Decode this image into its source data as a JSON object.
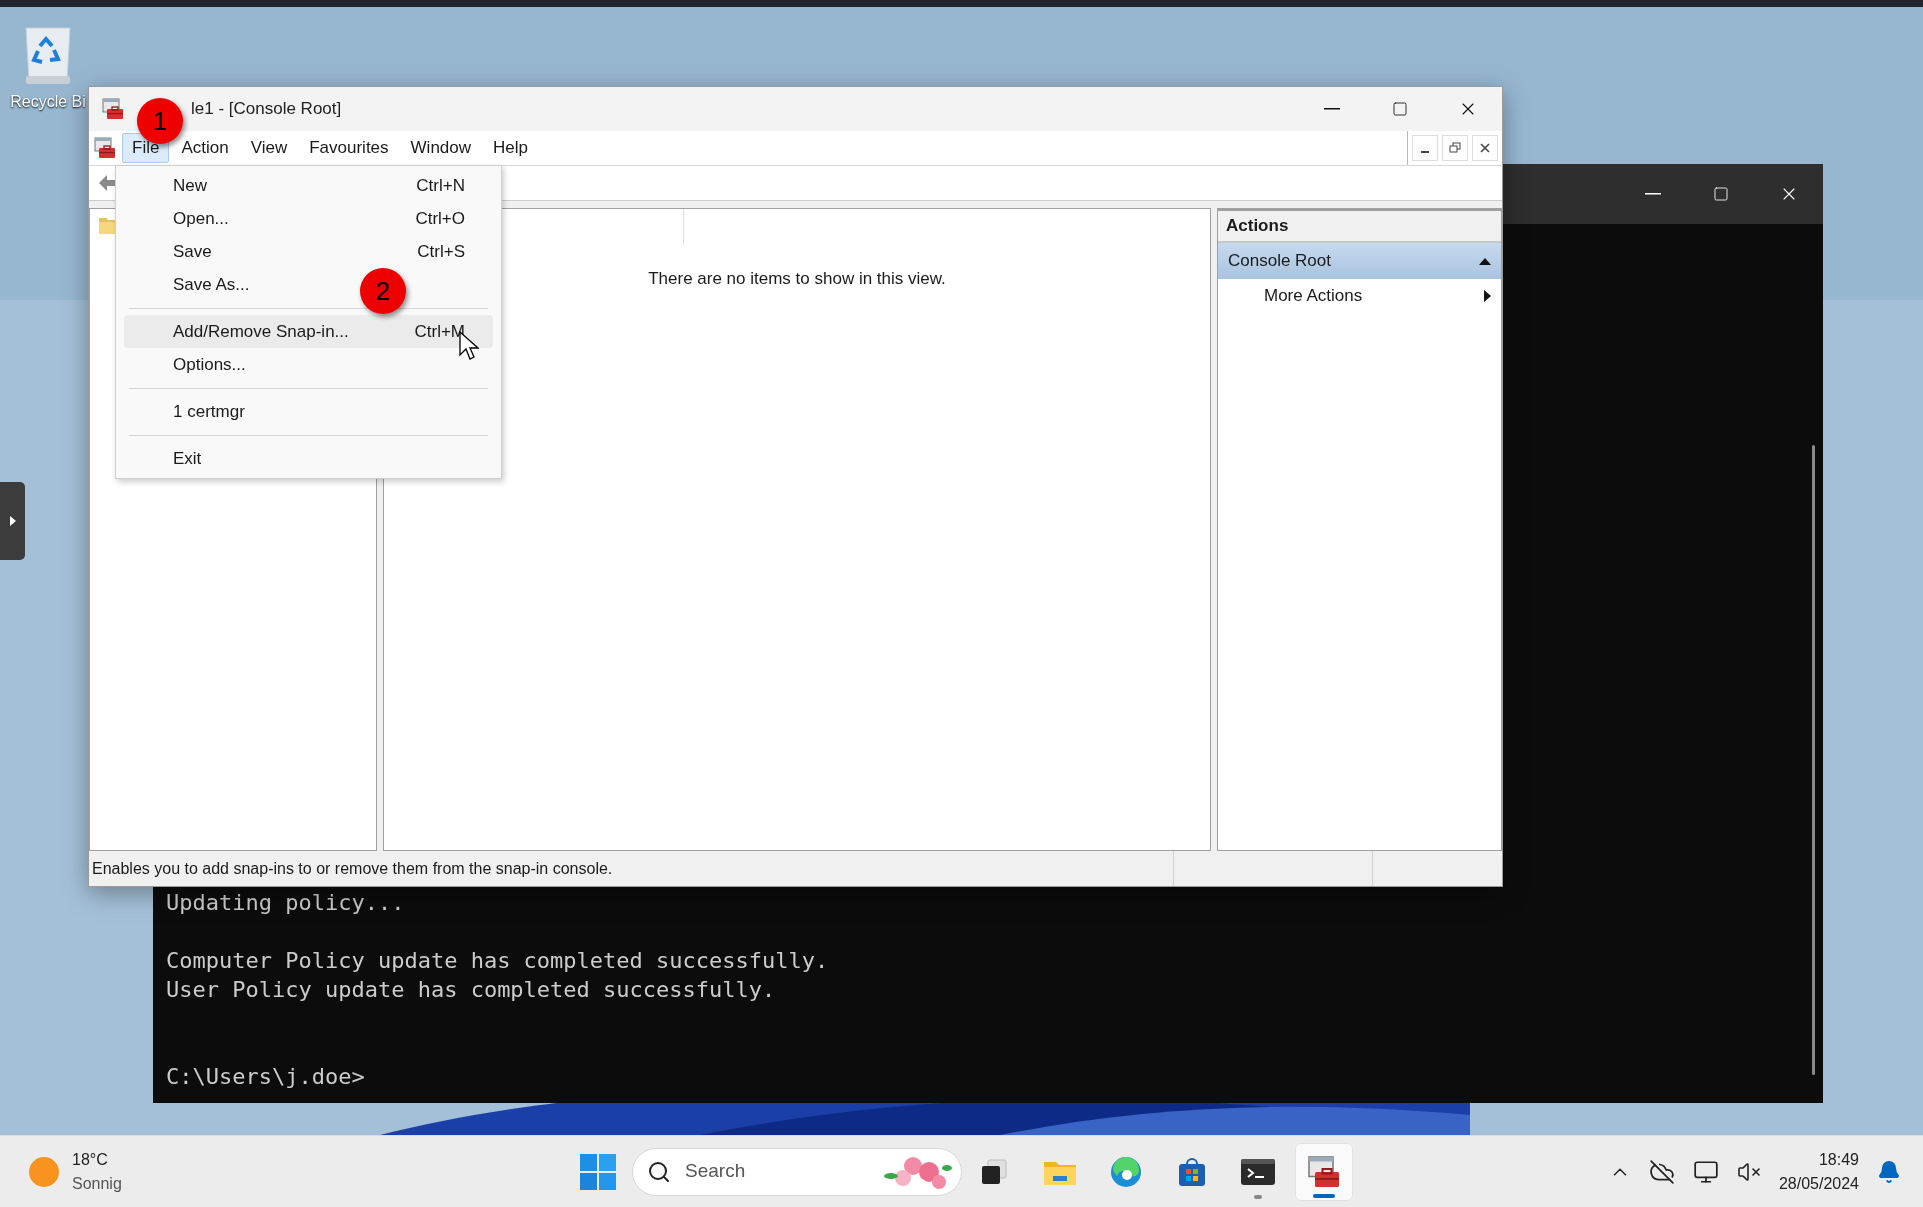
{
  "desktop": {
    "icons": [
      {
        "label": "Recycle Bi"
      }
    ]
  },
  "mmc_window": {
    "title": "le1 - [Console Root]",
    "menu": [
      {
        "label": "File",
        "selected": true
      },
      {
        "label": "Action",
        "selected": false
      },
      {
        "label": "View",
        "selected": false
      },
      {
        "label": "Favourites",
        "selected": false
      },
      {
        "label": "Window",
        "selected": false
      },
      {
        "label": "Help",
        "selected": false
      }
    ],
    "file_menu": [
      {
        "kind": "item",
        "label": "New",
        "shortcut": "Ctrl+N",
        "selected": false
      },
      {
        "kind": "item",
        "label": "Open...",
        "shortcut": "Ctrl+O",
        "selected": false
      },
      {
        "kind": "item",
        "label": "Save",
        "shortcut": "Ctrl+S",
        "selected": false
      },
      {
        "kind": "item",
        "label": "Save As...",
        "selected": false
      },
      {
        "kind": "separator"
      },
      {
        "kind": "item",
        "label": "Add/Remove Snap-in...",
        "shortcut": "Ctrl+M",
        "selected": true
      },
      {
        "kind": "item",
        "label": "Options...",
        "selected": false
      },
      {
        "kind": "separator"
      },
      {
        "kind": "item",
        "label": "1 certmgr",
        "selected": false
      },
      {
        "kind": "separator"
      },
      {
        "kind": "item",
        "label": "Exit",
        "selected": false
      }
    ],
    "center_pane": {
      "empty_message": "There are no items to show in this view."
    },
    "actions_pane": {
      "title": "Actions",
      "items": [
        {
          "kind": "group",
          "label": "Console Root",
          "selected": true
        },
        {
          "kind": "action",
          "label": "More Actions",
          "selected": false
        }
      ]
    },
    "status_bar": {
      "text": "Enables you to add snap-ins to or remove them from the snap-in console."
    }
  },
  "annotations": [
    {
      "label": "1"
    },
    {
      "label": "2"
    }
  ],
  "terminal": {
    "output": [
      [
        "Updating policy..."
      ],
      [
        "Computer Policy update has completed successfully.",
        "User Policy update has completed successfully."
      ]
    ],
    "prompt": "C:\\Users\\j.doe>"
  },
  "taskbar": {
    "weather": {
      "temperature": "18°C",
      "condition": "Sonnig"
    },
    "search": {
      "label": "Search"
    },
    "apps": [
      {
        "kind": "task-view",
        "running": false,
        "selected": false
      },
      {
        "kind": "explorer",
        "running": false,
        "selected": false
      },
      {
        "kind": "edge",
        "running": false,
        "selected": false
      },
      {
        "kind": "store",
        "running": false,
        "selected": false
      },
      {
        "kind": "terminal",
        "running": true,
        "selected": false
      },
      {
        "kind": "mmc",
        "running": true,
        "selected": true
      }
    ],
    "clock": {
      "time": "18:49",
      "date": "28/05/2024"
    }
  }
}
